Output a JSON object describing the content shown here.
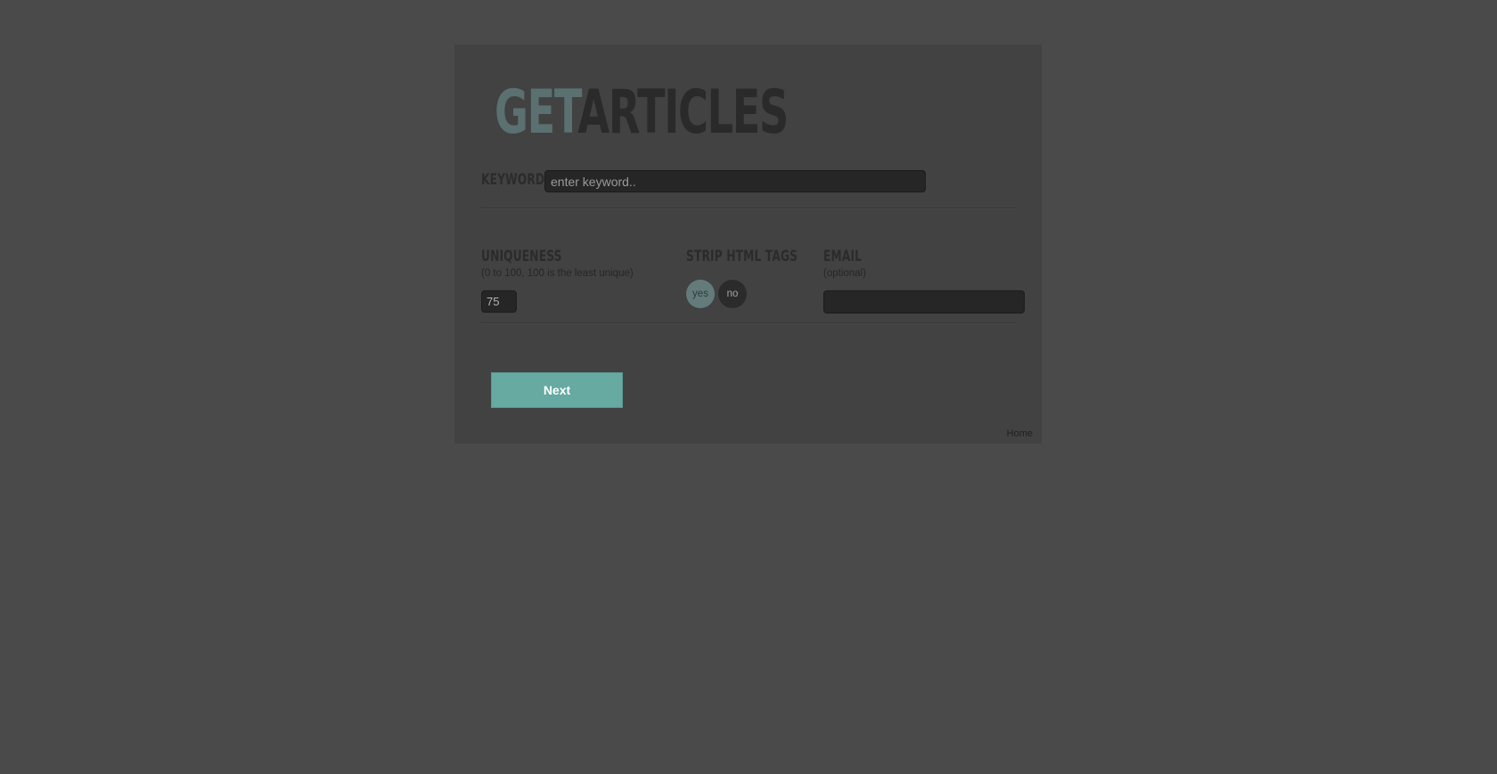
{
  "logo": {
    "part1": "GET",
    "part2": "ARTICLES"
  },
  "keyword": {
    "label": "KEYWORD",
    "placeholder": "enter keyword.."
  },
  "uniqueness": {
    "label": "UNIQUENESS",
    "hint": "(0 to 100, 100 is the least unique)",
    "value": "75"
  },
  "strip_html": {
    "label": "STRIP HTML TAGS",
    "options": [
      "yes",
      "no"
    ],
    "selected": "yes"
  },
  "email": {
    "label": "EMAIL",
    "hint": "(optional)",
    "value": ""
  },
  "actions": {
    "next_label": "Next"
  },
  "footer": {
    "home_label": "Home"
  },
  "colors": {
    "accent": "#66aaa2",
    "logo_accent": "#5b7070",
    "background": "#4a4a4a",
    "panel": "#424242"
  }
}
